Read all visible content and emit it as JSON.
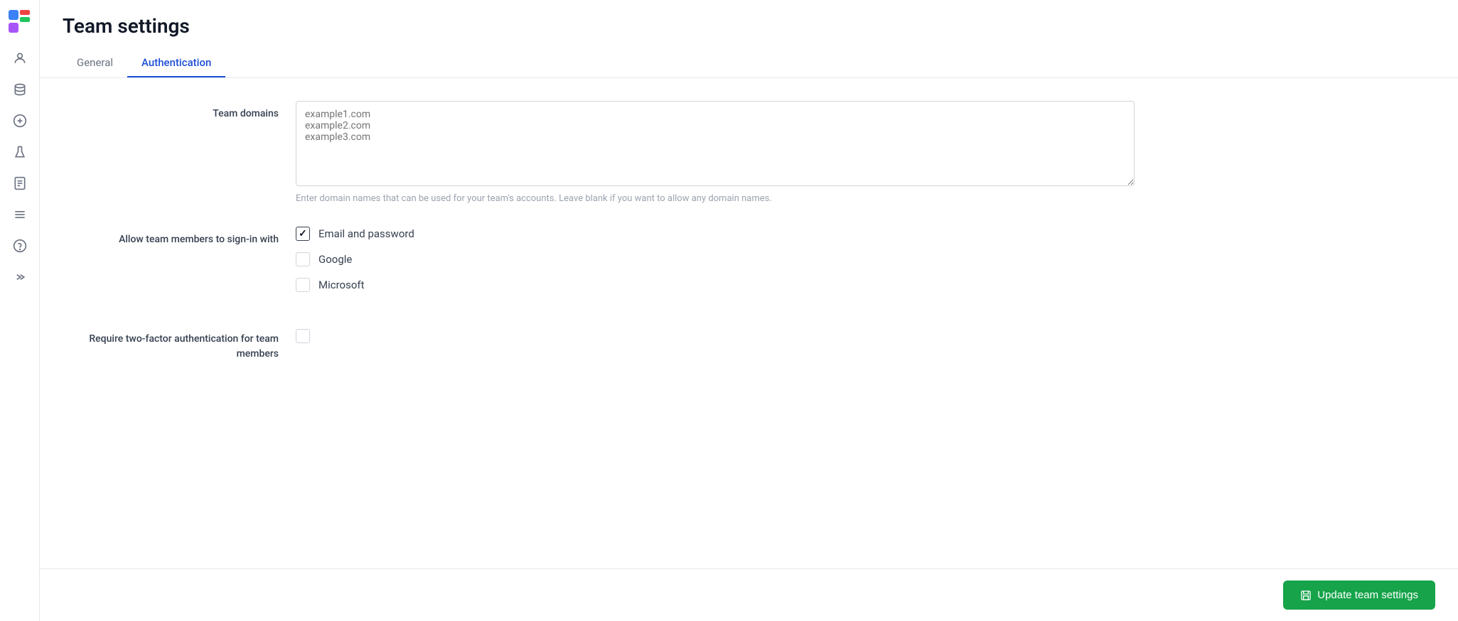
{
  "page": {
    "title": "Team settings"
  },
  "tabs": [
    {
      "id": "general",
      "label": "General",
      "active": false
    },
    {
      "id": "authentication",
      "label": "Authentication",
      "active": true
    }
  ],
  "sidebar": {
    "icons": [
      {
        "name": "user-icon",
        "symbol": "👤"
      },
      {
        "name": "database-icon",
        "symbol": "🗄"
      },
      {
        "name": "plus-icon",
        "symbol": "+"
      },
      {
        "name": "flask-icon",
        "symbol": "🧪"
      },
      {
        "name": "document-icon",
        "symbol": "📄"
      },
      {
        "name": "menu-icon",
        "symbol": "☰"
      },
      {
        "name": "help-icon",
        "symbol": "?"
      },
      {
        "name": "expand-icon",
        "symbol": ">>"
      }
    ]
  },
  "form": {
    "team_domains": {
      "label": "Team domains",
      "placeholder": "example1.com\nexample2.com\nexample3.com",
      "hint": "Enter domain names that can be used for your team's accounts. Leave blank if you want to allow any domain names."
    },
    "sign_in": {
      "label": "Allow team members to sign-in with",
      "options": [
        {
          "id": "email-password",
          "label": "Email and password",
          "checked": true
        },
        {
          "id": "google",
          "label": "Google",
          "checked": false
        },
        {
          "id": "microsoft",
          "label": "Microsoft",
          "checked": false
        }
      ]
    },
    "two_factor": {
      "label": "Require two-factor authentication for team members",
      "checked": false
    }
  },
  "footer": {
    "update_button_label": "Update team settings"
  }
}
